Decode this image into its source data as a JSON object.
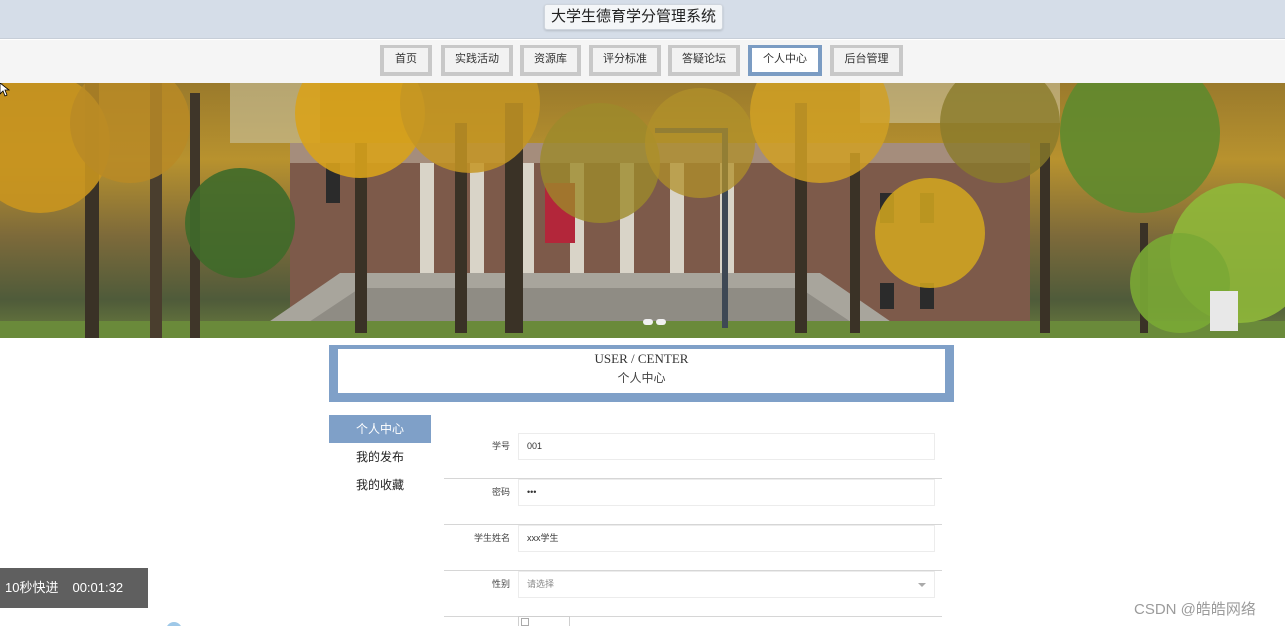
{
  "header": {
    "title": "大学生德育学分管理系统"
  },
  "nav": {
    "items": [
      {
        "label": "首页"
      },
      {
        "label": "实践活动"
      },
      {
        "label": "资源库"
      },
      {
        "label": "评分标准"
      },
      {
        "label": "答疑论坛"
      },
      {
        "label": "个人中心",
        "active": true
      },
      {
        "label": "后台管理"
      }
    ]
  },
  "banner": {
    "slides_visible": 2,
    "image": "campus-autumn-photo"
  },
  "center": {
    "title_en": "USER / CENTER",
    "title_cn": "个人中心"
  },
  "sidebar": {
    "items": [
      {
        "label": "个人中心",
        "active": true
      },
      {
        "label": "我的发布"
      },
      {
        "label": "我的收藏"
      }
    ]
  },
  "form": {
    "fields": [
      {
        "label": "学号",
        "value": "001"
      },
      {
        "label": "密码",
        "value": "•••"
      },
      {
        "label": "学生姓名",
        "value": "xxx学生"
      },
      {
        "label": "性别",
        "placeholder": "请选择"
      }
    ]
  },
  "overlay": {
    "skip_label": "10秒快进",
    "time": "00:01:32"
  },
  "watermark": "CSDN @皓皓网络",
  "colors": {
    "accent": "#7fa0c8",
    "header_bg": "#d5dde8"
  }
}
